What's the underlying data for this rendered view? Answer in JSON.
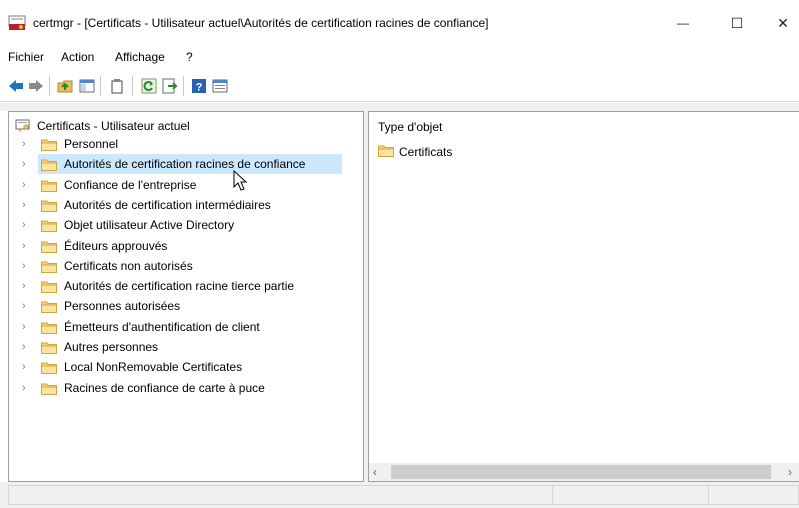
{
  "window": {
    "title": "certmgr - [Certificats - Utilisateur actuel\\Autorités de certification racines de confiance]",
    "min_glyph": "—",
    "max_glyph": "☐",
    "close_glyph": "✕"
  },
  "menu": {
    "items": [
      {
        "label": "Fichier"
      },
      {
        "label": "Action"
      },
      {
        "label": "Affichage"
      },
      {
        "label": "?"
      }
    ]
  },
  "toolbar": {
    "icons": [
      "back-icon",
      "forward-icon",
      "up-folder-icon",
      "show-tree-icon",
      "delete-icon",
      "refresh-icon",
      "export-icon",
      "help-icon",
      "properties-icon"
    ]
  },
  "tree": {
    "root": {
      "label": "Certificats - Utilisateur actuel"
    },
    "items": [
      {
        "label": "Personnel"
      },
      {
        "label": "Autorités de certification racines de confiance",
        "selected": true
      },
      {
        "label": "Confiance de l'entreprise"
      },
      {
        "label": "Autorités de certification intermédiaires"
      },
      {
        "label": "Objet utilisateur Active Directory"
      },
      {
        "label": "Éditeurs approuvés"
      },
      {
        "label": "Certificats non autorisés"
      },
      {
        "label": "Autorités de certification racine tierce partie"
      },
      {
        "label": "Personnes autorisées"
      },
      {
        "label": "Émetteurs d'authentification de client"
      },
      {
        "label": "Autres personnes"
      },
      {
        "label": "Local NonRemovable Certificates"
      },
      {
        "label": "Racines de confiance de carte à puce"
      }
    ],
    "chevron_glyph": "›"
  },
  "details": {
    "column_header": "Type d'objet",
    "items": [
      {
        "label": "Certificats"
      }
    ]
  },
  "colors": {
    "selection": "#cce8ff",
    "folder": "#f5d27a",
    "accent_blue": "#1e73be"
  }
}
